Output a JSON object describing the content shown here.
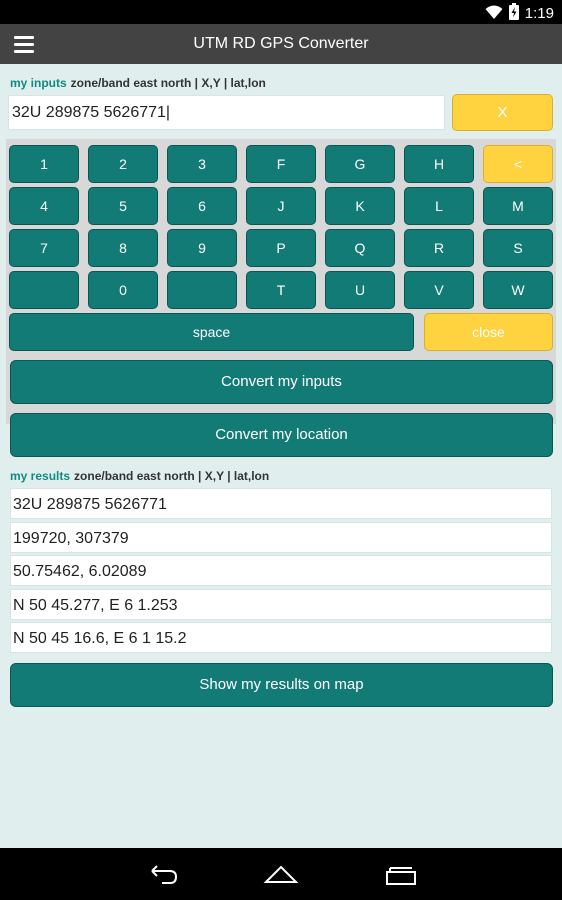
{
  "status_bar": {
    "time": "1:19"
  },
  "app_bar": {
    "title": "UTM RD GPS Converter"
  },
  "inputs": {
    "label": "my inputs",
    "format_hint": "zone/band east north | X,Y | lat,lon",
    "value": "32U 289875 5626771|",
    "clear_label": "X"
  },
  "keyboard": {
    "rows": [
      [
        "1",
        "2",
        "3",
        "F",
        "G",
        "H",
        "<"
      ],
      [
        "4",
        "5",
        "6",
        "J",
        "K",
        "L",
        "M"
      ],
      [
        "7",
        "8",
        "9",
        "P",
        "Q",
        "R",
        "S"
      ],
      [
        "",
        "0",
        "",
        "T",
        "U",
        "V",
        "W"
      ]
    ],
    "space_label": "space",
    "close_label": "close"
  },
  "actions": {
    "convert_inputs": "Convert my inputs",
    "convert_location": "Convert my location",
    "show_on_map": "Show my results on map"
  },
  "results": {
    "label": "my results",
    "format_hint": "zone/band east north | X,Y | lat,lon",
    "lines": [
      "32U 289875 5626771",
      "199720, 307379",
      "50.75462, 6.02089",
      "N 50 45.277, E 6 1.253",
      "N 50 45 16.6, E 6 1 15.2"
    ]
  },
  "colors": {
    "accent": "#127b76",
    "highlight": "#ffd23f",
    "background": "#e0efee"
  },
  "icons": [
    "wifi-icon",
    "battery-icon",
    "menu-icon",
    "back-icon",
    "home-icon",
    "recents-icon"
  ]
}
